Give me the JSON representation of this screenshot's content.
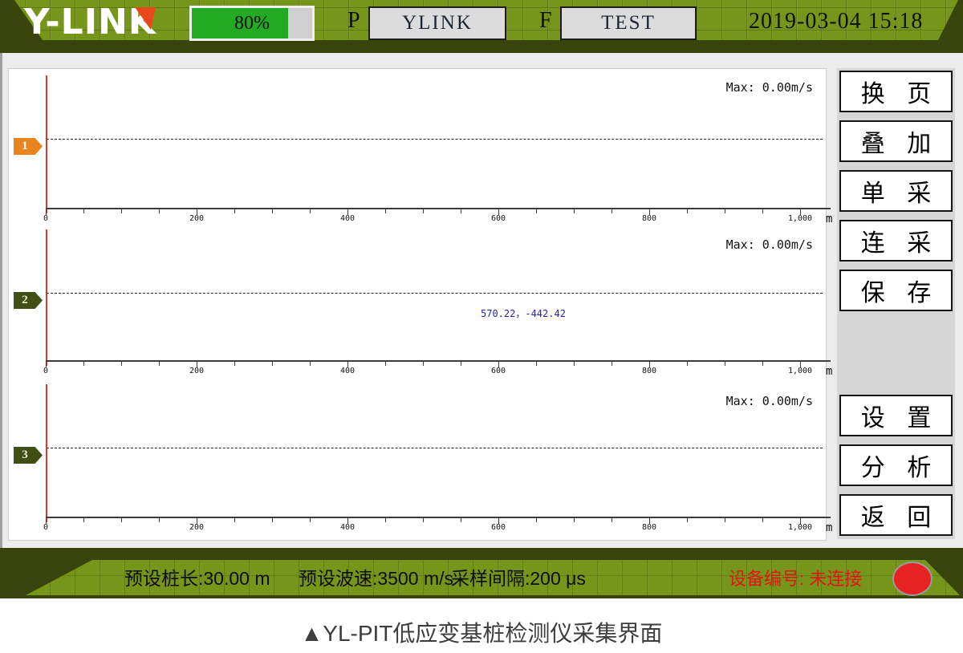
{
  "top_bar": {
    "logo_text": "Y-LINK",
    "battery_percent": "80%",
    "p_label": "P",
    "p_value": "YLINK",
    "f_label": "F",
    "f_value": "TEST",
    "datetime": "2019-03-04 15:18"
  },
  "buttons": [
    {
      "id": "page-switch",
      "label": "换 页"
    },
    {
      "id": "overlay",
      "label": "叠 加"
    },
    {
      "id": "single-sample",
      "label": "单 采"
    },
    {
      "id": "continuous-sample",
      "label": "连 采"
    },
    {
      "id": "save",
      "label": "保 存"
    },
    {
      "id": "settings",
      "label": "设 置"
    },
    {
      "id": "analysis",
      "label": "分 析"
    },
    {
      "id": "back",
      "label": "返 回"
    }
  ],
  "chart_data": {
    "type": "line",
    "x_axis": {
      "range": [
        0,
        1000
      ],
      "major_ticks": [
        0,
        200,
        400,
        600,
        800,
        1000
      ],
      "major_tick_labels": [
        "0",
        "200",
        "400",
        "600",
        "800",
        "1,000"
      ],
      "minor_tick_step": 50,
      "unit": "m"
    },
    "channels": [
      {
        "id": "1",
        "tag": "1",
        "tag_color": "#e8831d",
        "tag_text_color": "#ffffff",
        "max_label": "Max: 0.00m/s",
        "series": []
      },
      {
        "id": "2",
        "tag": "2",
        "tag_color": "#3f4f15",
        "tag_text_color": "#ece9c8",
        "max_label": "Max: 0.00m/s",
        "cursor_readout": "570.22，-442.42",
        "series": []
      },
      {
        "id": "3",
        "tag": "3",
        "tag_color": "#3f4f15",
        "tag_text_color": "#ece9c8",
        "max_label": "Max: 0.00m/s",
        "series": []
      }
    ]
  },
  "status_bar": {
    "items": [
      {
        "id": "pile-length",
        "text": "预设桩长:30.00 m"
      },
      {
        "id": "wave-speed",
        "text": "预设波速:3500 m/s"
      },
      {
        "id": "sample-interval",
        "text": "采样间隔:200 μs"
      }
    ],
    "device": {
      "text": "设备编号: 未连接",
      "status_color": "#e62222"
    }
  },
  "caption": {
    "text": "▲YL-PIT低应变基桩检测仪采集界面"
  },
  "colors": {
    "topbar_green": "#76961b",
    "dark_olive": "#39440d",
    "battery_fill": "#22ab22",
    "red_cursor_line": "#d93a2b",
    "readout_blue": "#2222bb",
    "status_red": "#e41414"
  }
}
